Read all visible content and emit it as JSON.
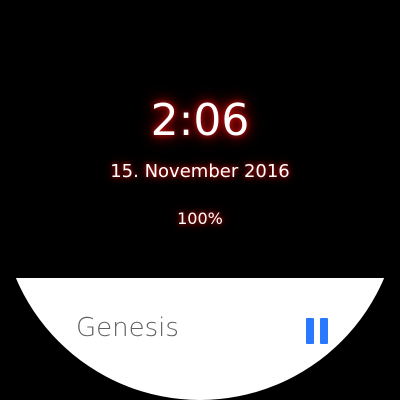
{
  "watch_face": {
    "time": "2:06",
    "date": "15. November 2016",
    "battery": "100%",
    "glow_color": "#d11313",
    "text_color": "#ffffff",
    "background": "#000000"
  },
  "media_card": {
    "title": "Genesis",
    "control_icon": "pause-icon",
    "accent_color": "#2979ff",
    "background": "#ffffff"
  }
}
